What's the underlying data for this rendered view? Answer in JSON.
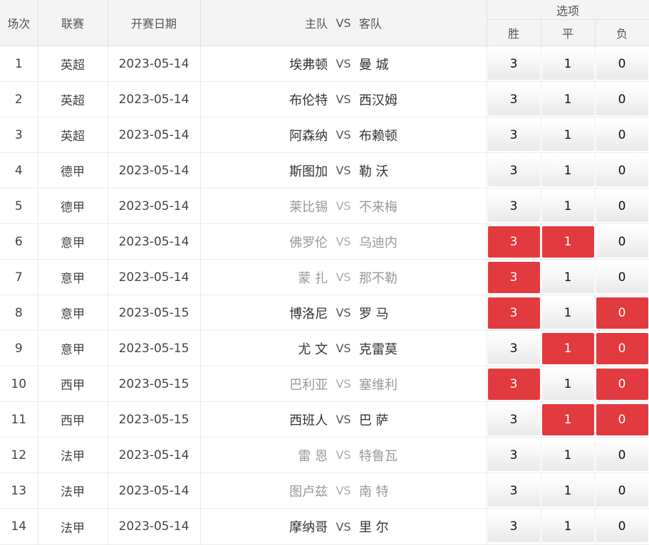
{
  "header": {
    "col_index": "场次",
    "col_league": "联赛",
    "col_date": "开赛日期",
    "col_match_home": "主队",
    "col_match_vs": "VS",
    "col_match_away": "客队",
    "col_options": "选项",
    "opt_win": "胜",
    "opt_draw": "平",
    "opt_lose": "负"
  },
  "colors": {
    "selected": "#e23b3f",
    "muted_team": "#999999"
  },
  "rows": [
    {
      "idx": "1",
      "league": "英超",
      "date": "2023-05-14",
      "home": "埃弗顿",
      "away": "曼 城",
      "muted": false,
      "win": "3",
      "draw": "1",
      "lose": "0",
      "sel": [
        false,
        false,
        false
      ]
    },
    {
      "idx": "2",
      "league": "英超",
      "date": "2023-05-14",
      "home": "布伦特",
      "away": "西汉姆",
      "muted": false,
      "win": "3",
      "draw": "1",
      "lose": "0",
      "sel": [
        false,
        false,
        false
      ]
    },
    {
      "idx": "3",
      "league": "英超",
      "date": "2023-05-14",
      "home": "阿森纳",
      "away": "布赖顿",
      "muted": false,
      "win": "3",
      "draw": "1",
      "lose": "0",
      "sel": [
        false,
        false,
        false
      ]
    },
    {
      "idx": "4",
      "league": "德甲",
      "date": "2023-05-14",
      "home": "斯图加",
      "away": "勒 沃",
      "muted": false,
      "win": "3",
      "draw": "1",
      "lose": "0",
      "sel": [
        false,
        false,
        false
      ]
    },
    {
      "idx": "5",
      "league": "德甲",
      "date": "2023-05-14",
      "home": "莱比锡",
      "away": "不来梅",
      "muted": true,
      "win": "3",
      "draw": "1",
      "lose": "0",
      "sel": [
        false,
        false,
        false
      ]
    },
    {
      "idx": "6",
      "league": "意甲",
      "date": "2023-05-14",
      "home": "佛罗伦",
      "away": "乌迪内",
      "muted": true,
      "win": "3",
      "draw": "1",
      "lose": "0",
      "sel": [
        true,
        true,
        false
      ]
    },
    {
      "idx": "7",
      "league": "意甲",
      "date": "2023-05-14",
      "home": "蒙 扎",
      "away": "那不勒",
      "muted": true,
      "win": "3",
      "draw": "1",
      "lose": "0",
      "sel": [
        true,
        false,
        false
      ]
    },
    {
      "idx": "8",
      "league": "意甲",
      "date": "2023-05-15",
      "home": "博洛尼",
      "away": "罗 马",
      "muted": false,
      "win": "3",
      "draw": "1",
      "lose": "0",
      "sel": [
        true,
        false,
        true
      ]
    },
    {
      "idx": "9",
      "league": "意甲",
      "date": "2023-05-15",
      "home": "尤 文",
      "away": "克雷莫",
      "muted": false,
      "win": "3",
      "draw": "1",
      "lose": "0",
      "sel": [
        false,
        true,
        true
      ]
    },
    {
      "idx": "10",
      "league": "西甲",
      "date": "2023-05-15",
      "home": "巴利亚",
      "away": "塞维利",
      "muted": true,
      "win": "3",
      "draw": "1",
      "lose": "0",
      "sel": [
        true,
        false,
        true
      ]
    },
    {
      "idx": "11",
      "league": "西甲",
      "date": "2023-05-15",
      "home": "西班人",
      "away": "巴 萨",
      "muted": false,
      "win": "3",
      "draw": "1",
      "lose": "0",
      "sel": [
        false,
        true,
        true
      ]
    },
    {
      "idx": "12",
      "league": "法甲",
      "date": "2023-05-14",
      "home": "雷 恩",
      "away": "特鲁瓦",
      "muted": true,
      "win": "3",
      "draw": "1",
      "lose": "0",
      "sel": [
        false,
        false,
        false
      ]
    },
    {
      "idx": "13",
      "league": "法甲",
      "date": "2023-05-14",
      "home": "图卢兹",
      "away": "南 特",
      "muted": true,
      "win": "3",
      "draw": "1",
      "lose": "0",
      "sel": [
        false,
        false,
        false
      ]
    },
    {
      "idx": "14",
      "league": "法甲",
      "date": "2023-05-14",
      "home": "摩纳哥",
      "away": "里 尔",
      "muted": false,
      "win": "3",
      "draw": "1",
      "lose": "0",
      "sel": [
        false,
        false,
        false
      ]
    }
  ]
}
